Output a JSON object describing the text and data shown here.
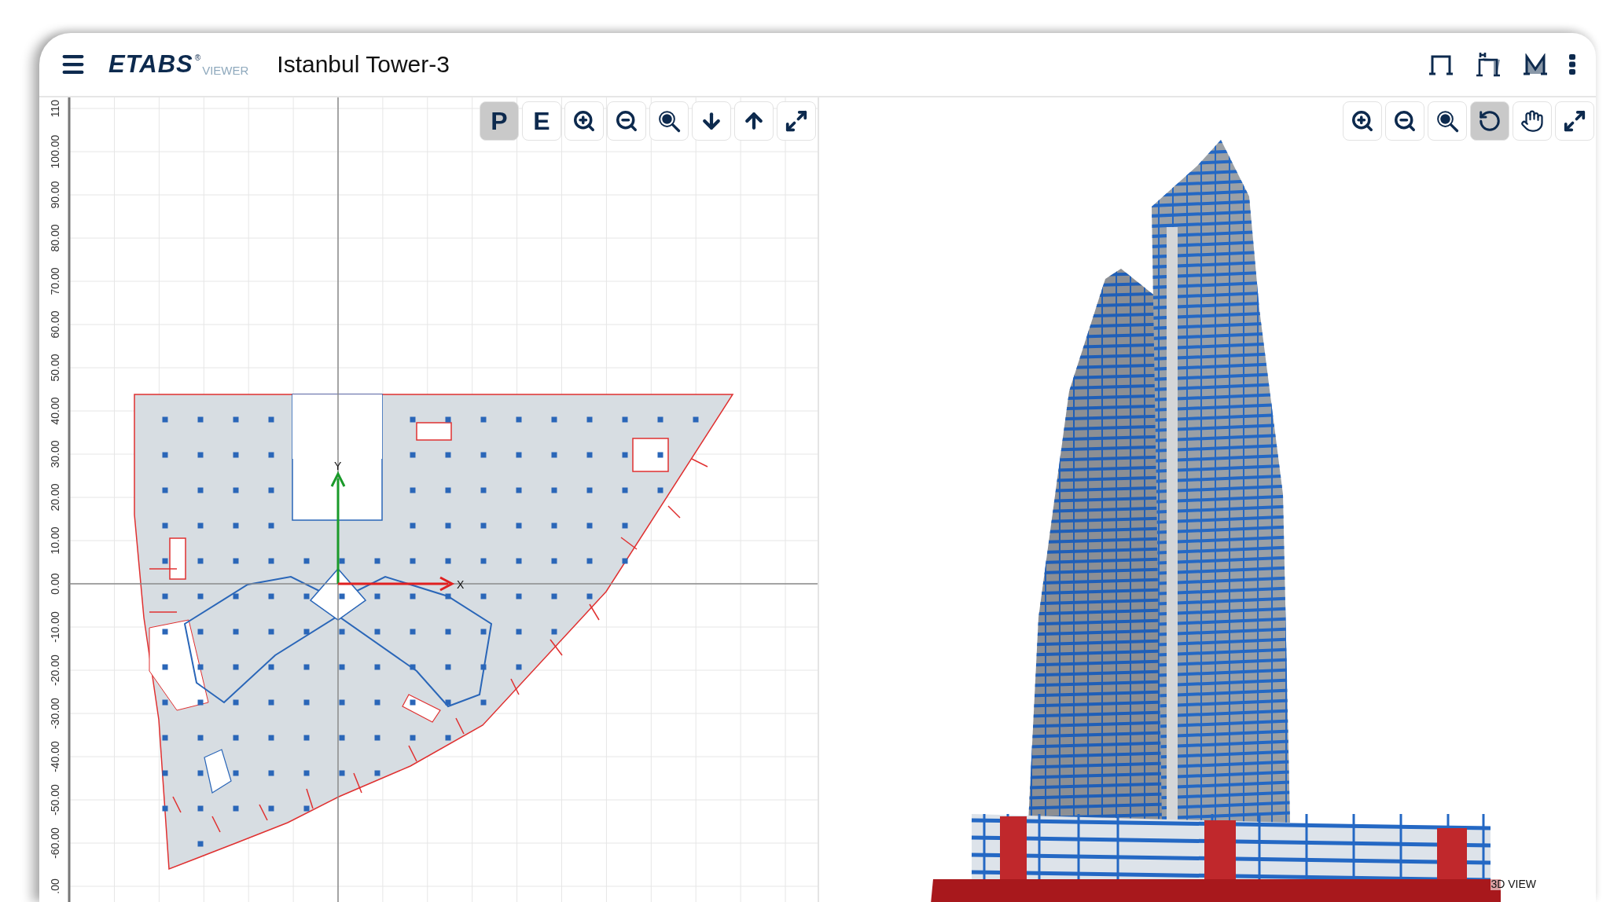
{
  "header": {
    "logo": {
      "name": "ETABS",
      "mark": "®",
      "sub": "VIEWER"
    },
    "title": "Istanbul Tower-3",
    "actions": [
      {
        "kind": "frame"
      },
      {
        "kind": "frame-h"
      },
      {
        "kind": "frame-m"
      },
      {
        "kind": "more"
      }
    ]
  },
  "plan_view": {
    "toolbar": [
      {
        "kind": "text",
        "label": "P",
        "selected": true
      },
      {
        "kind": "text",
        "label": "E",
        "selected": false
      },
      {
        "kind": "zoom-in",
        "selected": false
      },
      {
        "kind": "zoom-out",
        "selected": false
      },
      {
        "kind": "zoom-fit",
        "selected": false
      },
      {
        "kind": "down",
        "selected": false
      },
      {
        "kind": "up",
        "selected": false
      },
      {
        "kind": "expand",
        "selected": false
      }
    ],
    "y_ticks": [
      "110",
      "100.00",
      "90.00",
      "80.00",
      "70.00",
      "60.00",
      "50.00",
      "40.00",
      "30.00",
      "20.00",
      "10.00",
      "0.00",
      "-10.00",
      "-20.00",
      "-30.00",
      "-40.00",
      "-50.00",
      "-60.00",
      ".00"
    ],
    "axis_x": "X",
    "axis_y": "Y"
  },
  "view_3d": {
    "toolbar": [
      {
        "kind": "zoom-in",
        "selected": false
      },
      {
        "kind": "zoom-out",
        "selected": false
      },
      {
        "kind": "zoom-fit",
        "selected": false
      },
      {
        "kind": "rotate",
        "selected": true
      },
      {
        "kind": "pan",
        "selected": false
      },
      {
        "kind": "expand",
        "selected": false
      }
    ],
    "label": "3D VIEW"
  }
}
